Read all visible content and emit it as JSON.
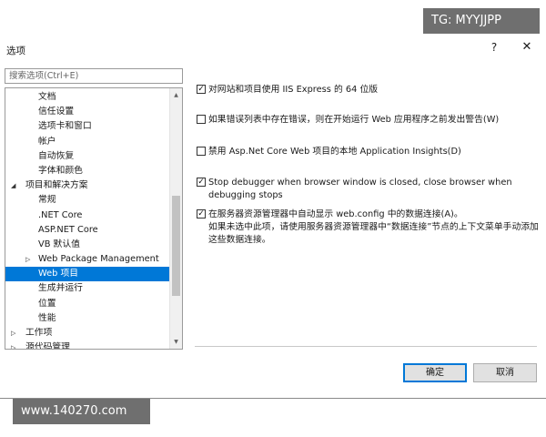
{
  "watermark": {
    "top": "TG: MYYJJPP",
    "bottom": "www.140270.com"
  },
  "dialog": {
    "title": "选项",
    "help_glyph": "?",
    "close_glyph": "✕"
  },
  "search": {
    "placeholder": "搜索选项(Ctrl+E)"
  },
  "tree": {
    "items": [
      {
        "label": "文档",
        "indent": 2,
        "arrow": ""
      },
      {
        "label": "信任设置",
        "indent": 2,
        "arrow": ""
      },
      {
        "label": "选项卡和窗口",
        "indent": 2,
        "arrow": ""
      },
      {
        "label": "帐户",
        "indent": 2,
        "arrow": ""
      },
      {
        "label": "自动恢复",
        "indent": 2,
        "arrow": ""
      },
      {
        "label": "字体和颜色",
        "indent": 2,
        "arrow": ""
      },
      {
        "label": "项目和解决方案",
        "indent": 1,
        "arrow": "expanded"
      },
      {
        "label": "常规",
        "indent": 2,
        "arrow": ""
      },
      {
        "label": ".NET Core",
        "indent": 2,
        "arrow": ""
      },
      {
        "label": "ASP.NET Core",
        "indent": 2,
        "arrow": ""
      },
      {
        "label": "VB 默认值",
        "indent": 2,
        "arrow": ""
      },
      {
        "label": "Web Package Management",
        "indent": 2,
        "arrow": "collapsed"
      },
      {
        "label": "Web 项目",
        "indent": 2,
        "arrow": "",
        "selected": true
      },
      {
        "label": "生成并运行",
        "indent": 2,
        "arrow": ""
      },
      {
        "label": "位置",
        "indent": 2,
        "arrow": ""
      },
      {
        "label": "性能",
        "indent": 2,
        "arrow": ""
      },
      {
        "label": "工作项",
        "indent": 1,
        "arrow": "collapsed"
      },
      {
        "label": "源代码管理",
        "indent": 1,
        "arrow": "collapsed"
      }
    ],
    "scroll_up_glyph": "▲",
    "scroll_down_glyph": "▼"
  },
  "options": [
    {
      "checked": true,
      "text": "对网站和项目使用 IIS Express 的 64 位版"
    },
    {
      "checked": false,
      "text": "如果错误列表中存在错误，则在开始运行 Web 应用程序之前发出警告(W)"
    },
    {
      "checked": false,
      "text": "禁用 Asp.Net Core Web 项目的本地 Application Insights(D)"
    },
    {
      "checked": true,
      "text": "Stop debugger when browser window is closed, close browser when debugging stops"
    },
    {
      "checked": true,
      "text": "在服务器资源管理器中自动显示 web.config 中的数据连接(A)。",
      "note": "如果未选中此项，请使用服务器资源管理器中“数据连接”节点的上下文菜单手动添加这些数据连接。"
    }
  ],
  "buttons": {
    "ok": "确定",
    "cancel": "取消"
  },
  "check_glyph": "✓",
  "colors": {
    "selection": "#0078d7",
    "watermark_bg": "#6f6f6f"
  }
}
